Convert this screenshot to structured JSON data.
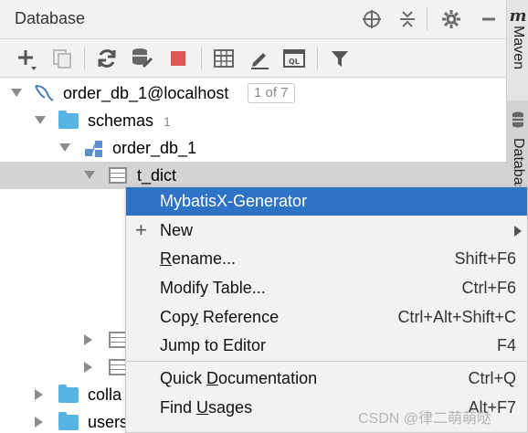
{
  "panel": {
    "title": "Database"
  },
  "tree": {
    "connection": {
      "name": "order_db_1@localhost",
      "badge": "1 of 7"
    },
    "schemas": {
      "name": "schemas",
      "count": "1"
    },
    "schema": {
      "name": "order_db_1"
    },
    "table": {
      "name": "t_dict"
    },
    "collations": {
      "name": "colla"
    },
    "users": {
      "name": "users"
    }
  },
  "context_menu": {
    "items": [
      {
        "label": "MybatisX-Generator",
        "shortcut": ""
      },
      {
        "label": "New",
        "shortcut": ""
      },
      {
        "label_pre": "",
        "label_u": "R",
        "label_post": "ename...",
        "shortcut": "Shift+F6"
      },
      {
        "label": "Modify Table...",
        "shortcut": "Ctrl+F6"
      },
      {
        "label_pre": "Cop",
        "label_u": "y",
        "label_post": " Reference",
        "shortcut": "Ctrl+Alt+Shift+C"
      },
      {
        "label": "Jump to Editor",
        "shortcut": "F4"
      },
      {
        "label_pre": "Quick ",
        "label_u": "D",
        "label_post": "ocumentation",
        "shortcut": "Ctrl+Q"
      },
      {
        "label_pre": "Find ",
        "label_u": "U",
        "label_post": "sages",
        "shortcut": "Alt+F7"
      }
    ]
  },
  "side_tabs": {
    "maven": "Maven",
    "database": "Database"
  },
  "watermark": "CSDN @律二萌萌哒",
  "colors": {
    "highlight": "#2e73c4",
    "selected_row": "#d4d4d4",
    "folder": "#56b4e5",
    "stop": "#e05555"
  }
}
